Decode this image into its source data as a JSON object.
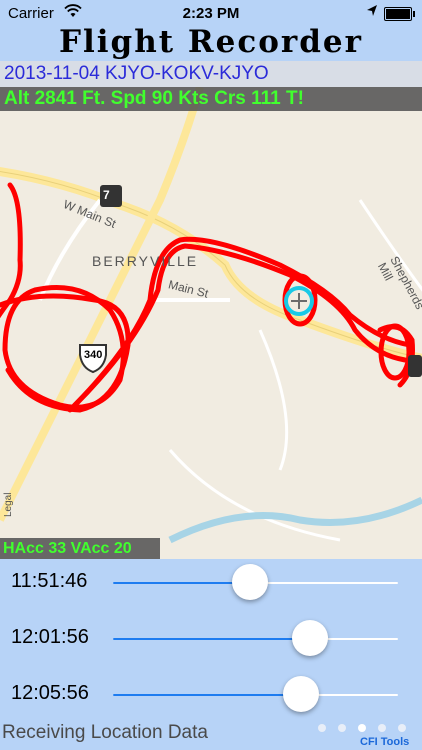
{
  "status_bar": {
    "carrier": "Carrier",
    "time": "2:23 PM"
  },
  "app": {
    "title": "Flight Recorder"
  },
  "route": {
    "label": "2013-11-04 KJYO-KOKV-KJYO"
  },
  "flight_info": {
    "text": "Alt 2841 Ft. Spd  90 Kts Crs 111 T!"
  },
  "accuracy": {
    "text": "HAcc  33 VAcc  20"
  },
  "map": {
    "town": "BERRYVILLE",
    "streets": [
      "W Main St",
      "Main St",
      "Shepherds Mill"
    ],
    "highway_shields": [
      "7",
      "340"
    ],
    "legal": "Legal",
    "colors": {
      "track": "#ff0000",
      "position_marker": "#19c9e6"
    }
  },
  "sliders": [
    {
      "time": "11:51:46",
      "level": 0.48
    },
    {
      "time": "12:01:56",
      "level": 0.69
    },
    {
      "time": "12:05:56",
      "level": 0.66
    }
  ],
  "footer": {
    "status": "Receiving Location Data",
    "page_dots": 5,
    "active_page": 3,
    "tools_label": "CFI Tools"
  },
  "colors": {
    "accent": "#1e7cf0",
    "background": "#b7d3f7",
    "route_text": "#2b2bd9",
    "info_text": "#41ff2e"
  }
}
